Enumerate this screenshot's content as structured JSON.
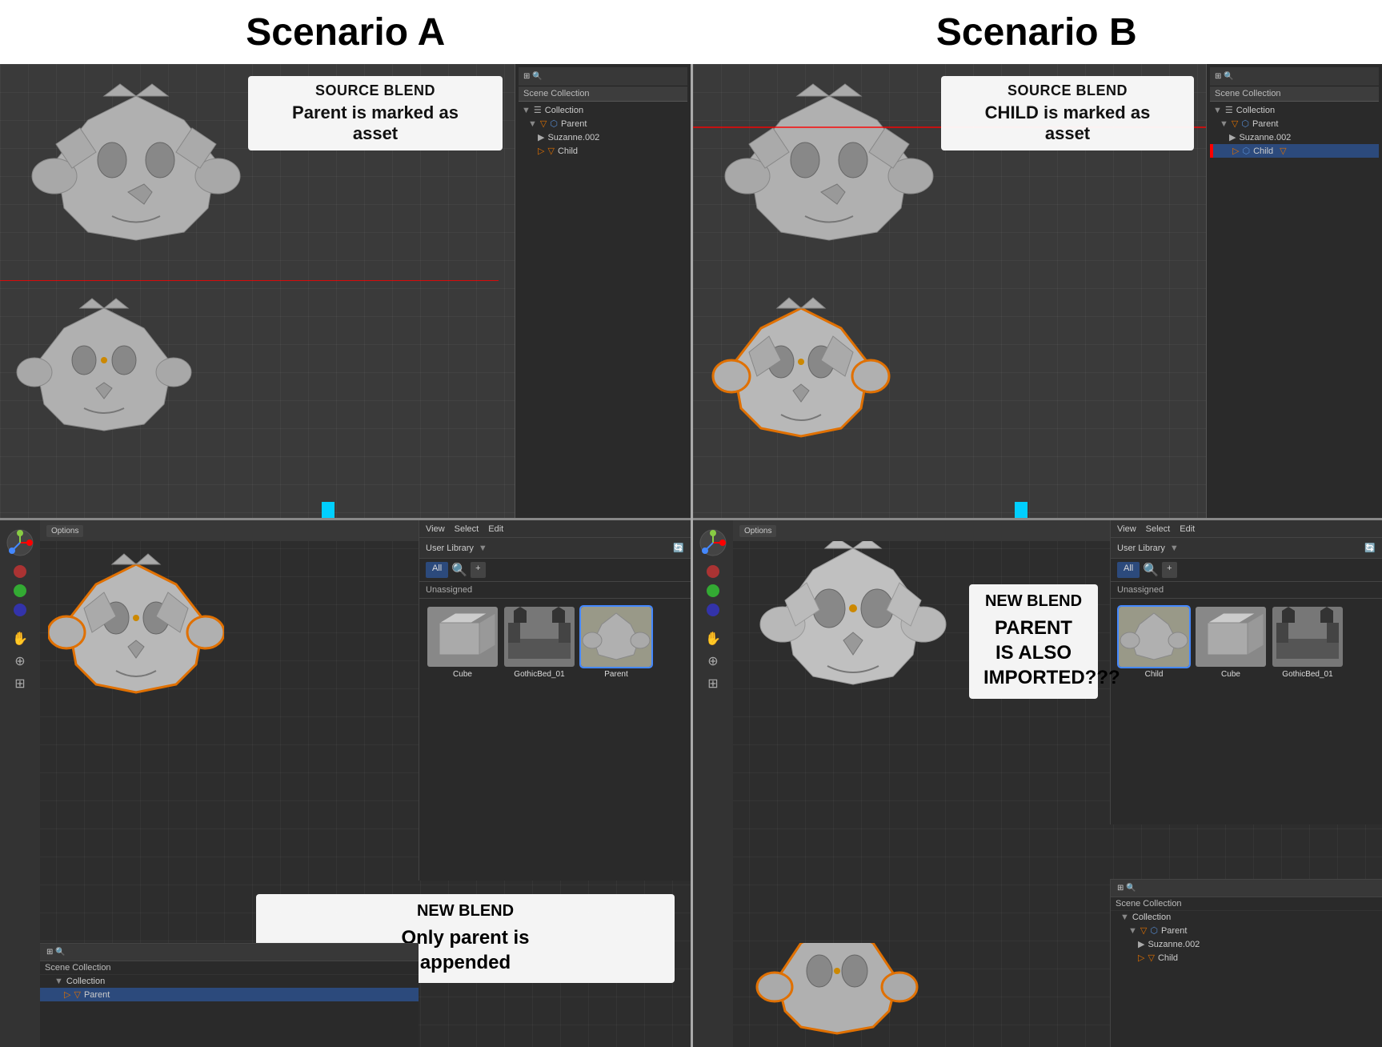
{
  "titles": {
    "a": "Scenario A",
    "b": "Scenario B"
  },
  "scenarioA": {
    "source": {
      "label": "SOURCE BLEND",
      "desc_line1": "Parent is marked as",
      "desc_line2": "asset"
    },
    "new": {
      "label": "NEW BLEND",
      "desc_line1": "Only parent is",
      "desc_line2": "appended"
    },
    "outliner_source": {
      "header": "Scene Collection",
      "items": [
        {
          "label": "Collection",
          "indent": 0,
          "icon": "folder"
        },
        {
          "label": "Parent",
          "indent": 1,
          "icon": "armature"
        },
        {
          "label": "Suzanne.002",
          "indent": 2,
          "icon": "mesh"
        },
        {
          "label": "Child",
          "indent": 2,
          "icon": "triangle"
        }
      ]
    },
    "outliner_new": {
      "header": "Scene Collection",
      "items": [
        {
          "label": "Collection",
          "indent": 0,
          "icon": "folder"
        },
        {
          "label": "Parent",
          "indent": 1,
          "icon": "triangle"
        }
      ]
    },
    "asset_browser": {
      "library": "User Library",
      "items": [
        "All",
        "Unassigned"
      ],
      "assets": [
        {
          "name": "Cube",
          "selected": false
        },
        {
          "name": "GothicBed_01",
          "selected": false
        },
        {
          "name": "Parent",
          "selected": true
        }
      ]
    }
  },
  "scenarioB": {
    "source": {
      "label": "SOURCE BLEND",
      "desc_line1": "CHILD is marked as",
      "desc_line2": "asset"
    },
    "new": {
      "label": "NEW BLEND",
      "desc_line1": "PARENT IS ALSO",
      "desc_line2": "IMPORTED???"
    },
    "outliner_source": {
      "header": "Scene Collection",
      "items": [
        {
          "label": "Collection",
          "indent": 0,
          "icon": "folder"
        },
        {
          "label": "Parent",
          "indent": 1,
          "icon": "armature"
        },
        {
          "label": "Suzanne.002",
          "indent": 2,
          "icon": "mesh"
        },
        {
          "label": "Child",
          "indent": 2,
          "icon": "triangle",
          "selected": true
        }
      ]
    },
    "outliner_new": {
      "header": "Scene Collection",
      "items": [
        {
          "label": "Collection",
          "indent": 0,
          "icon": "folder"
        },
        {
          "label": "Parent",
          "indent": 1,
          "icon": "armature"
        },
        {
          "label": "Suzanne.002",
          "indent": 2,
          "icon": "mesh"
        },
        {
          "label": "Child",
          "indent": 2,
          "icon": "triangle"
        }
      ]
    },
    "asset_browser": {
      "library": "User Library",
      "items": [
        "All",
        "Unassigned"
      ],
      "assets": [
        {
          "name": "Child",
          "selected": true
        },
        {
          "name": "Cube",
          "selected": false
        },
        {
          "name": "GothicBed_01",
          "selected": false
        }
      ]
    }
  },
  "ui": {
    "options_label": "Options",
    "view_label": "View",
    "select_label": "Select",
    "edit_label": "Edit"
  }
}
